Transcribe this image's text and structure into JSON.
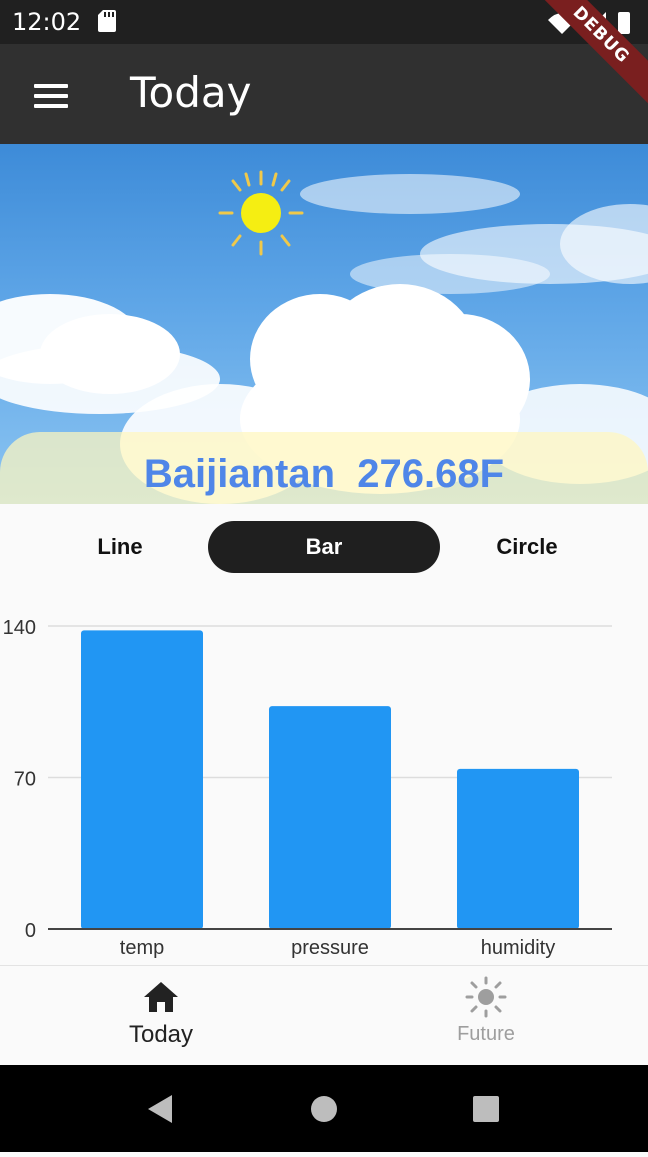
{
  "status_bar": {
    "time": "12:02"
  },
  "app_bar": {
    "title": "Today",
    "debug_banner": "DEBUG"
  },
  "weather": {
    "city": "Baijiantan",
    "temperature": "276.68F"
  },
  "chart_toggle": {
    "options": [
      "Line",
      "Bar",
      "Circle"
    ],
    "selected": "Bar"
  },
  "chart_data": {
    "type": "bar",
    "categories": [
      "temp",
      "pressure",
      "humidity"
    ],
    "values": [
      138,
      103,
      74
    ],
    "ylim": [
      0,
      140
    ],
    "yticks": [
      0,
      70,
      140
    ],
    "grid": true,
    "color": "#2196f3"
  },
  "bottom_nav": {
    "items": [
      {
        "label": "Today",
        "icon": "home-icon",
        "active": true
      },
      {
        "label": "Future",
        "icon": "sun-icon",
        "active": false
      }
    ]
  },
  "colors": {
    "appbar": "#303030",
    "accent_text": "#4f86e8",
    "bar": "#2196f3"
  }
}
